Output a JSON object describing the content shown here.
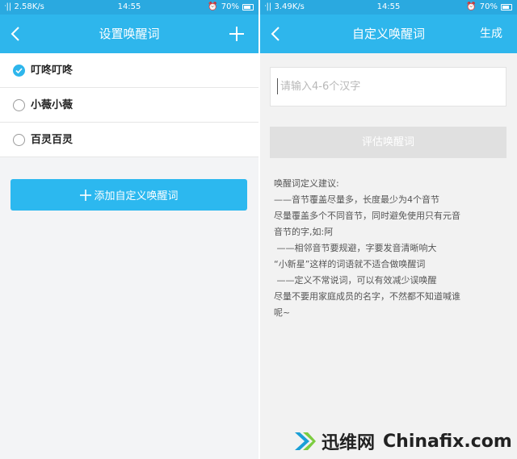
{
  "left": {
    "status": {
      "signal": "ᐧ|| 2.58K/s",
      "time": "14:55",
      "battery": "70%"
    },
    "nav": {
      "title": "设置唤醒词"
    },
    "items": [
      {
        "label": "叮咚叮咚",
        "selected": true
      },
      {
        "label": "小薇小薇",
        "selected": false
      },
      {
        "label": "百灵百灵",
        "selected": false
      }
    ],
    "add_button": {
      "label": "添加自定义唤醒词"
    }
  },
  "right": {
    "status": {
      "signal": "ᐧ|| 3.49K/s",
      "time": "14:55",
      "battery": "70%"
    },
    "nav": {
      "title": "自定义唤醒词",
      "action": "生成"
    },
    "input": {
      "placeholder": "请输入4-6个汉字",
      "value": ""
    },
    "eval_button": {
      "label": "评估唤醒词"
    },
    "tips": {
      "title": "唤醒词定义建议:",
      "lines": [
        "——音节覆盖尽量多，长度最少为4个音节",
        "尽量覆盖多个不同音节，同时避免使用只有元音",
        "音节的字,如:阿",
        " ——相邻音节要规避，字要发音清晰响大",
        "“小新星”这样的词语就不适合做唤醒词",
        " ——定义不常说词，可以有效减少误唤醒",
        "尽量不要用家庭成员的名字，不然都不知道喊谁",
        "呢~"
      ]
    }
  },
  "watermark": {
    "cn": "迅维网",
    "en": "Chinafix.com"
  },
  "colors": {
    "status": "#2aa9e0",
    "nav": "#2eb6ec",
    "accent": "#2cb8ef",
    "disabled": "#e0e0e0"
  }
}
